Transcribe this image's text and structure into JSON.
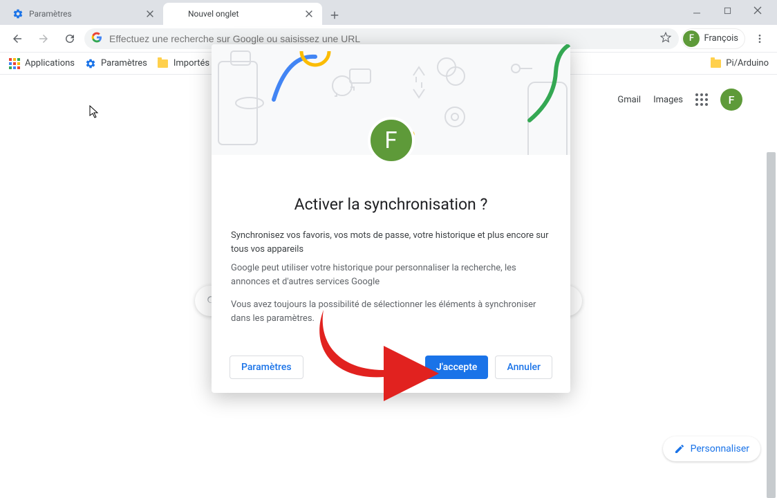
{
  "tabs": [
    {
      "title": "Paramètres",
      "active": false
    },
    {
      "title": "Nouvel onglet",
      "active": true
    }
  ],
  "omnibox_placeholder": "Effectuez une recherche sur Google ou saisissez une URL",
  "profile": {
    "initial": "F",
    "name": "François"
  },
  "bookmarks": {
    "apps": "Applications",
    "settings": "Paramètres",
    "imported": "Importés de…",
    "piardu": "Pi/Arduino"
  },
  "ntp_links": {
    "gmail": "Gmail",
    "images": "Images"
  },
  "personalize_label": "Personnaliser",
  "modal": {
    "avatar_initial": "F",
    "heading": "Activer la synchronisation ?",
    "p1": "Synchronisez vos favoris, vos mots de passe, votre historique et plus encore sur tous vos appareils",
    "p2": "Google peut utiliser votre historique pour personnaliser la recherche, les annonces et d'autres services Google",
    "p3": "Vous avez toujours la possibilité de sélectionner les éléments à synchroniser dans les paramètres.",
    "btn_settings": "Paramètres",
    "btn_accept": "J'accepte",
    "btn_cancel": "Annuler"
  }
}
